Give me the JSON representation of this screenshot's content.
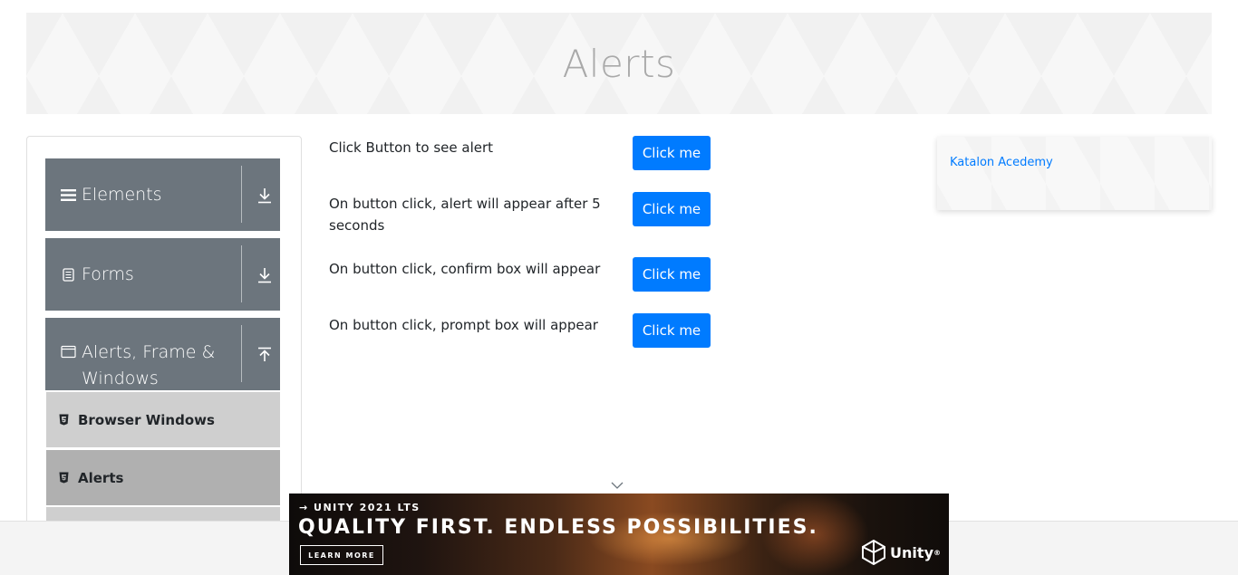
{
  "page": {
    "title": "Alerts"
  },
  "sidebar": {
    "groups": [
      {
        "label": "Elements",
        "icon": "hamburger-icon",
        "toggle": "download-arrow-icon"
      },
      {
        "label": "Forms",
        "icon": "document-icon",
        "toggle": "download-arrow-icon"
      },
      {
        "label": "Alerts, Frame &",
        "label2": "Windows",
        "icon": "window-icon",
        "toggle": "upload-arrow-icon"
      }
    ],
    "items": [
      {
        "label": "Browser Windows",
        "icon": "html5-icon"
      },
      {
        "label": "Alerts",
        "icon": "html5-icon",
        "active": true
      }
    ]
  },
  "rows": [
    {
      "text": "Click Button to see alert",
      "button": "Click me"
    },
    {
      "text": "On button click, alert will appear after 5 seconds",
      "button": "Click me"
    },
    {
      "text": "On button click, confirm box will appear",
      "button": "Click me"
    },
    {
      "text": "On button click, prompt box will appear",
      "button": "Click me"
    }
  ],
  "right_card": {
    "link": "Katalon Acedemy"
  },
  "ad": {
    "kicker": "→ UNITY 2021 LTS",
    "headline": "QUALITY FIRST. ENDLESS POSSIBILITIES.",
    "cta": "LEARN MORE",
    "brand": "Unity",
    "brand_mark": "®"
  },
  "colors": {
    "accent": "#007bff",
    "sidebar_header": "#6c757d",
    "item_bg": "#cfcfcf",
    "item_active_bg": "#b0b0b0"
  }
}
